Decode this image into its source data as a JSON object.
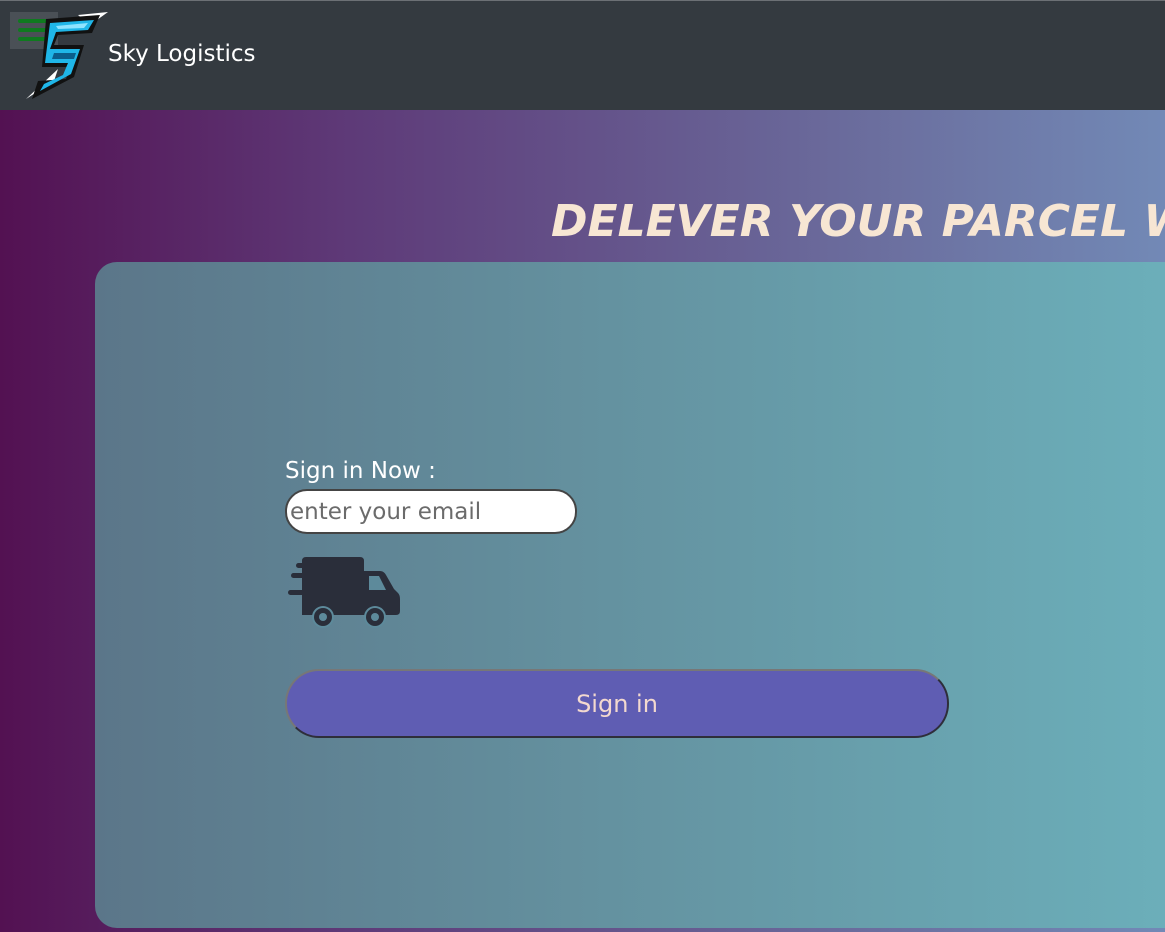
{
  "navbar": {
    "brand_name": "Sky Logistics",
    "menu_toggle_icon": "hamburger-menu-icon",
    "logo_icon": "lightning-s-logo-icon",
    "colors": {
      "background": "#343a40",
      "menu_lines": "#0f7a1f"
    }
  },
  "hero": {
    "title": "DELEVER YOUR PARCEL WI",
    "colors": {
      "title": "#f7e6d3",
      "gradient_start": "#531152",
      "gradient_end": "#7289b6"
    }
  },
  "signin": {
    "label": "Sign in Now :",
    "email_placeholder": "enter your email",
    "truck_icon": "delivery-truck-icon",
    "button_label": "Sign in",
    "colors": {
      "button": "#5f5db3",
      "button_text": "#f3d9cf",
      "card_start": "#5b7689",
      "card_end": "#6cb0bb"
    }
  }
}
